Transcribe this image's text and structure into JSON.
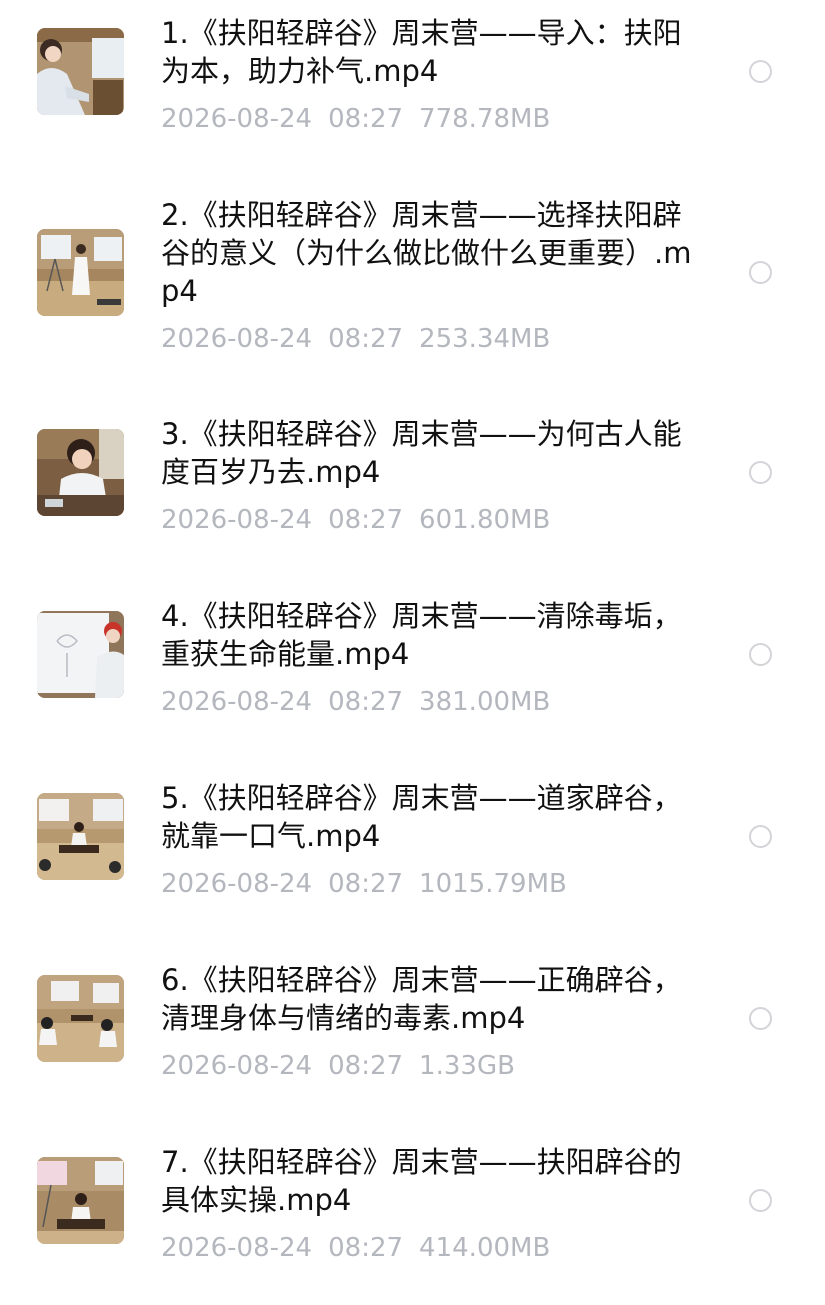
{
  "files": [
    {
      "name": "1.《扶阳轻辟谷》周末营——导入：扶阳为本，助力补气.mp4",
      "date": "2026-08-24",
      "time": "08:27",
      "size": "778.78MB",
      "thumbnail": "person-seated-classroom",
      "selected": false
    },
    {
      "name": "2.《扶阳轻辟谷》周末营——选择扶阳辟谷的意义（为什么做比做什么更重要）.mp4",
      "date": "2026-08-24",
      "time": "08:27",
      "size": "253.34MB",
      "thumbnail": "presenter-standing-between-screens",
      "selected": false
    },
    {
      "name": "3.《扶阳轻辟谷》周末营——为何古人能度百岁乃去.mp4",
      "date": "2026-08-24",
      "time": "08:27",
      "size": "601.80MB",
      "thumbnail": "speaker-closeup-at-desk",
      "selected": false
    },
    {
      "name": "4.《扶阳轻辟谷》周末营——清除毒垢，重获生命能量.mp4",
      "date": "2026-08-24",
      "time": "08:27",
      "size": "381.00MB",
      "thumbnail": "speaker-by-whiteboard",
      "selected": false
    },
    {
      "name": "5.《扶阳轻辟谷》周末营——道家辟谷，就靠一口气.mp4",
      "date": "2026-08-24",
      "time": "08:27",
      "size": "1015.79MB",
      "thumbnail": "classroom-with-screens",
      "selected": false
    },
    {
      "name": "6.《扶阳轻辟谷》周末营——正确辟谷，清理身体与情绪的毒素.mp4",
      "date": "2026-08-24",
      "time": "08:27",
      "size": "1.33GB",
      "thumbnail": "classroom-audience",
      "selected": false
    },
    {
      "name": "7.《扶阳轻辟谷》周末营——扶阳辟谷的具体实操.mp4",
      "date": "2026-08-24",
      "time": "08:27",
      "size": "414.00MB",
      "thumbnail": "teacher-at-table",
      "selected": false
    }
  ],
  "colors": {
    "title": "#111111",
    "meta": "#b4b7be",
    "radio_border": "#d2d4d8",
    "background": "#ffffff"
  }
}
